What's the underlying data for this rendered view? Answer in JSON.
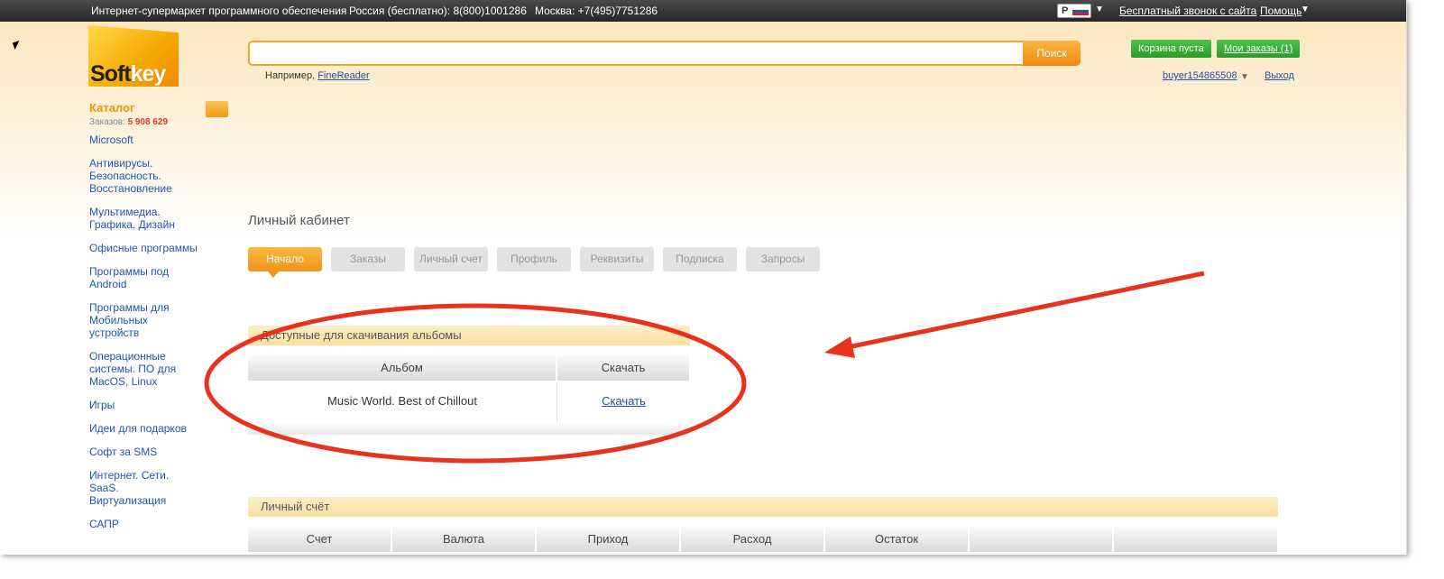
{
  "topbar": {
    "tagline": "Интернет-супермаркет программного обеспечения",
    "phone_russia": "Россия (бесплатно): 8(800)1001286",
    "phone_moscow": "Москва: +7(495)7751286",
    "currency": "Р",
    "callback_link": "Бесплатный звонок с сайта",
    "help_link": "Помощь"
  },
  "logo": {
    "text_a": "Soft",
    "text_b": "key"
  },
  "search": {
    "placeholder": "",
    "button": "Поиск",
    "hint_prefix": "Например, ",
    "hint_link": "FineReader"
  },
  "cart": {
    "cart_label": "Корзина пуста",
    "orders_label": "Мои заказы (1)"
  },
  "user": {
    "name": "buyer154865508",
    "logout": "Выход"
  },
  "catalog": {
    "title": "Каталог",
    "orders_prefix": "Заказов: ",
    "orders_count": "5 908 629",
    "items": [
      "Microsoft",
      "Антивирусы. Безопасность. Восстановление",
      "Мультимедиа. Графика. Дизайн",
      "Офисные программы",
      "Программы под Android",
      "Программы для Мобильных устройств",
      "Операционные системы. ПО для MacOS, Linux",
      "Игры",
      "Идеи для подарков",
      "Софт за SMS",
      "Интернет. Сети. SaaS. Виртуализация",
      "САПР"
    ]
  },
  "page_title": "Личный кабинет",
  "tabs": [
    "Начало",
    "Заказы",
    "Личный счет",
    "Профиль",
    "Реквизиты",
    "Подписка",
    "Запросы"
  ],
  "albums": {
    "heading": "Доступные для скачивания альбомы",
    "col_album": "Альбом",
    "col_download": "Скачать",
    "rows": [
      {
        "album": "Music World. Best of Chillout",
        "download": "Скачать"
      }
    ]
  },
  "account": {
    "heading": "Личный счёт",
    "columns": [
      "Счет",
      "Валюта",
      "Приход",
      "Расход",
      "Остаток",
      "",
      ""
    ]
  },
  "colors": {
    "accent_orange": "#f39a10",
    "link_blue": "#1c4ea8",
    "annotation_red": "#e8321c",
    "green_button": "#2b9a2a"
  }
}
